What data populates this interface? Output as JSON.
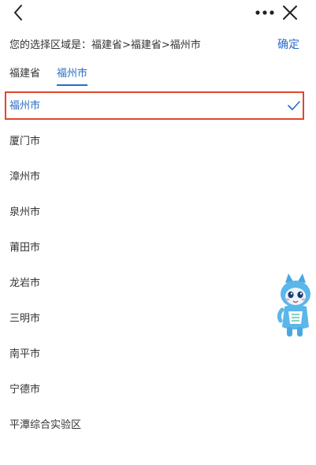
{
  "nav": {
    "back_icon": "chevron-left-icon",
    "more_icon": "more-dots-icon",
    "close_icon": "close-icon"
  },
  "summary": {
    "text": "您的选择区域是：福建省>福建省>福州市",
    "confirm_label": "确定"
  },
  "tabs": [
    {
      "label": "福建省",
      "active": false
    },
    {
      "label": "福州市",
      "active": true
    }
  ],
  "cities": [
    {
      "label": "福州市",
      "selected": true
    },
    {
      "label": "厦门市",
      "selected": false
    },
    {
      "label": "漳州市",
      "selected": false
    },
    {
      "label": "泉州市",
      "selected": false
    },
    {
      "label": "莆田市",
      "selected": false
    },
    {
      "label": "龙岩市",
      "selected": false
    },
    {
      "label": "三明市",
      "selected": false
    },
    {
      "label": "南平市",
      "selected": false
    },
    {
      "label": "宁德市",
      "selected": false
    },
    {
      "label": "平潭综合实验区",
      "selected": false
    }
  ],
  "colors": {
    "accent": "#2a6bc6",
    "highlight": "#e2462c",
    "text": "#333333"
  },
  "mascot_icon": "mascot-icon"
}
